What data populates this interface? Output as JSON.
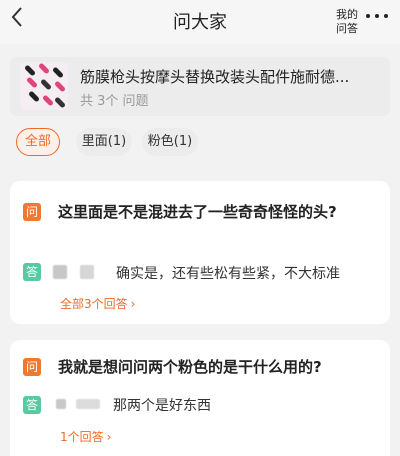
{
  "nav": {
    "back_icon": "chevron-left-icon",
    "title": "问大家",
    "my_questions": "我的\n问答",
    "more_icon": "more-dots-icon"
  },
  "product": {
    "title": "筋膜枪头按摩头替换改装头配件施耐德...",
    "count": "共 3个 问题",
    "thumb_icon": "product-thumbnail"
  },
  "filters": [
    {
      "label": "全部",
      "active": true
    },
    {
      "label": "里面(1)",
      "active": false
    },
    {
      "label": "粉色(1)",
      "active": false
    }
  ],
  "questions": [
    {
      "q_badge": "问",
      "question": "这里面是不是混进去了一些奇奇怪怪的头?",
      "a_badge": "答",
      "answer": "确实是，还有些松有些紧，不大标准",
      "link": "全部3个回答",
      "link_chevron": "›"
    },
    {
      "q_badge": "问",
      "question": "我就是想问问两个粉色的是干什么用的?",
      "a_badge": "答",
      "answer": "那两个是好东西",
      "link": "1个回答",
      "link_chevron": "›"
    }
  ],
  "colors": {
    "accent": "#ee6a29",
    "question_badge": "#ef7a2f",
    "answer_badge": "#58c9a0",
    "background": "#f2f2f2"
  }
}
